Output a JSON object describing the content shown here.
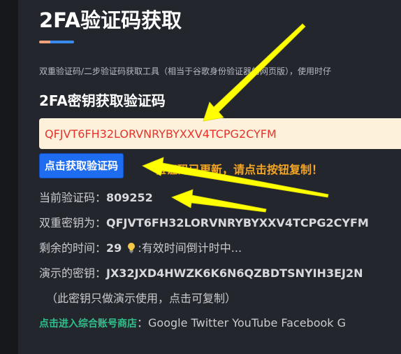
{
  "header": {
    "title": "2FA验证码获取",
    "description": "双重验证码/二步验证码获取工具（相当于谷歌身份验证器的网页版），使用时仔"
  },
  "form": {
    "subtitle": "2FA密钥获取验证码",
    "secret_value": "QFJVT6FH32LORVNRYBYXXV4TCPG2CYFM",
    "get_button_label": "点击获取验证码",
    "notice": "验证码已更新，请点击按钮复制！"
  },
  "info": {
    "current_code_label": "当前验证码：",
    "current_code_value": "809252",
    "secret_label": "双重密钥为：",
    "secret_value": "QFJVT6FH32LORVNRYBYXXV4TCPG2CYFM",
    "remaining_label": "剩余的时间：",
    "remaining_value": "29",
    "remaining_hint": ":有效时间倒计时中...",
    "demo_label": "演示的密钥：",
    "demo_value": "JX32JXD4HWZK6K6N6QZBDTSNYIH3EJ2N",
    "demo_note": "（此密钥只做演示使用，点击可复制）",
    "shop_link": "点击进入综合账号商店",
    "shop_separator": "：",
    "shop_brands": "Google Twitter YouTube Facebook G"
  },
  "colors": {
    "page_bg": "#24262d",
    "outer_bg": "#17181c",
    "accent_blue": "#1e6cf0",
    "notice_orange": "#f5a623",
    "input_bg": "#fdf1dc",
    "input_text": "#e8322a",
    "link_green": "#2fc08a",
    "annotation_yellow": "#ffff00"
  },
  "icons": {
    "hint": "lightbulb-icon"
  }
}
